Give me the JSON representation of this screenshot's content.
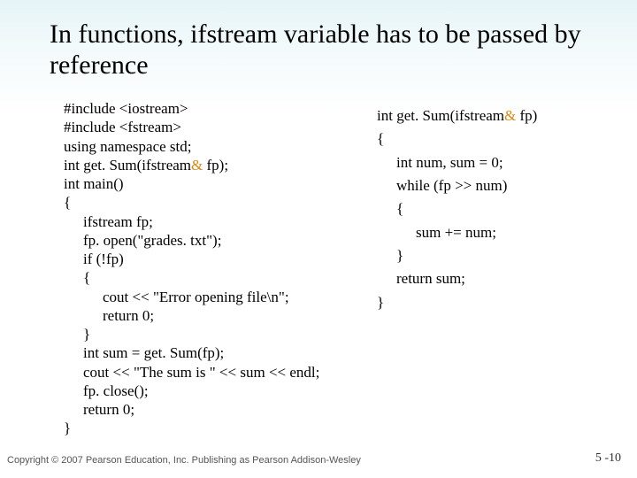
{
  "title": "In functions, ifstream variable has to be passed by reference",
  "left": {
    "l1": "#include <iostream>",
    "l2": "#include <fstream>",
    "l3": "using namespace std;",
    "l4a": "int get. Sum(ifstream",
    "l4amp": "&",
    "l4b": " fp);",
    "l5": "int main()",
    "l6": "{",
    "l7": "ifstream fp;",
    "l8": "fp. open(\"grades. txt\");",
    "l9": "if (!fp)",
    "l10": "{",
    "l11": "cout << \"Error opening file\\n\";",
    "l12": "return 0;",
    "l13": "}",
    "l14": "int sum = get. Sum(fp);",
    "l15": "cout << \"The sum is \" << sum << endl;",
    "l16": "fp. close();",
    "l17": "return 0;",
    "l18": "}"
  },
  "right": {
    "r1a": "int get. Sum(ifstream",
    "r1amp": "&",
    "r1b": " fp)",
    "r2": "{",
    "r3": "int num, sum = 0;",
    "r4": "while (fp >> num)",
    "r5": "{",
    "r6": "sum += num;",
    "r7": "}",
    "r8": "return sum;",
    "r9": "}"
  },
  "footer": "Copyright © 2007 Pearson Education, Inc. Publishing as Pearson Addison-Wesley",
  "pagenum": "5 -10"
}
